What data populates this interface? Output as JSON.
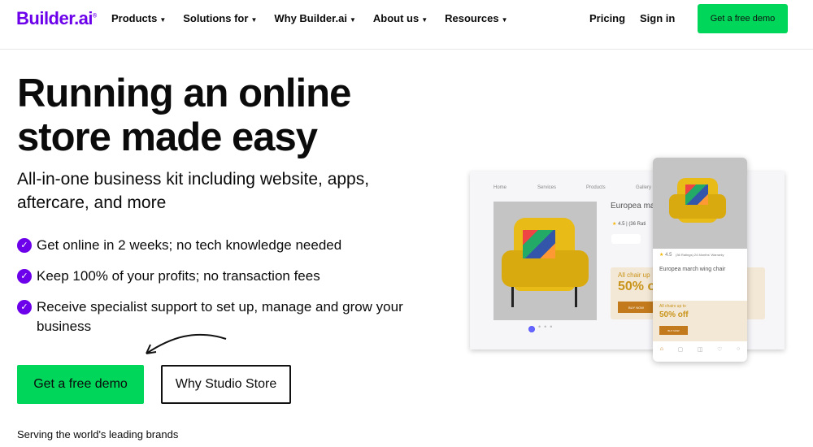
{
  "nav": {
    "logo": "Builder.ai",
    "items": [
      "Products",
      "Solutions for",
      "Why Builder.ai",
      "About us",
      "Resources"
    ],
    "pricing": "Pricing",
    "signin": "Sign in",
    "demo": "Get a free demo"
  },
  "hero": {
    "title": "Running an online store made easy",
    "subtitle": "All-in-one business kit including website, apps, aftercare, and more",
    "features": [
      "Get online in 2 weeks; no tech knowledge needed",
      "Keep 100% of your profits; no transaction fees",
      "Receive specialist support to set up, manage and grow your business"
    ],
    "cta_primary": "Get a free demo",
    "cta_secondary": "Why Studio Store",
    "serving": "Serving the world's leading brands"
  },
  "mockup": {
    "nav": [
      "Home",
      "Services",
      "Products",
      "Gallery"
    ],
    "product": "Europea march wing chair",
    "product_short": "Europea ma",
    "rating": "4.5",
    "ratings_text": "(36 Ratings) 24 Months' Warranty",
    "ratings_short": "(36 Rati",
    "promo": "All chairs up to",
    "promo_short": "All chair up",
    "discount": "50% off",
    "discount_short": "50% o",
    "buy": "BUY NOW"
  },
  "colors": {
    "brand": "#6c00ea",
    "cta": "#00d659",
    "chair": "#e8bb17",
    "promo": "#c27a1c"
  }
}
